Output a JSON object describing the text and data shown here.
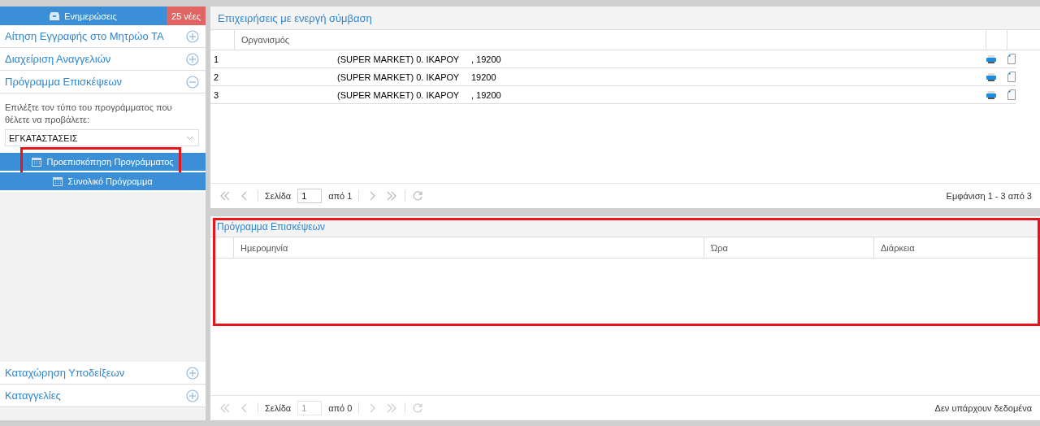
{
  "sidebar": {
    "notifications": {
      "label": "Ενημερώσεις",
      "badge": "25 νέες"
    },
    "items_top": [
      {
        "label": "Αίτηση Εγγραφής στο Μητρώο ΤΑ",
        "expanded": false
      },
      {
        "label": "Διαχείριση Αναγγελιών",
        "expanded": false
      },
      {
        "label": "Πρόγραμμα Επισκέψεων",
        "expanded": true
      }
    ],
    "panel": {
      "prompt": "Επιλέξτε τον τύπο του προγράμματος που θέλετε να προβάλετε:",
      "select_value": "ΕΓΚΑΤΑΣΤΑΣΕΙΣ",
      "buttons": [
        {
          "label": "Προεπισκόπηση Προγράμματος",
          "highlighted": true
        },
        {
          "label": "Συνολικό Πρόγραμμα",
          "highlighted": false
        }
      ]
    },
    "items_bottom": [
      {
        "label": "Καταχώρηση Υποδείξεων",
        "expanded": false
      },
      {
        "label": "Καταγγελίες",
        "expanded": false
      }
    ]
  },
  "companies": {
    "title": "Επιχειρήσεις με ενεργή σύμβαση",
    "columns": [
      "Οργανισμός"
    ],
    "rows": [
      {
        "number": "1",
        "name": "(SUPER MARKET) 0. ΙΚΑΡΟΥ",
        "address": ", 19200"
      },
      {
        "number": "2",
        "name": "(SUPER MARKET) 0. ΙΚΑΡΟΥ",
        "address": "19200"
      },
      {
        "number": "3",
        "name": "(SUPER MARKET) 0. ΙΚΑΡΟΥ",
        "address": ", 19200"
      }
    ],
    "pager": {
      "page_label": "Σελίδα",
      "page": "1",
      "of": "από 1",
      "info": "Εμφάνιση 1 - 3 από 3",
      "disabled": false
    }
  },
  "schedule": {
    "title": "Πρόγραμμα Επισκέψεων",
    "highlighted": true,
    "columns": [
      "Ημερομηνία",
      "Ώρα",
      "Διάρκεια"
    ],
    "pager": {
      "page_label": "Σελίδα",
      "page": "1",
      "of": "από 0",
      "info": "Δεν υπάρχουν δεδομένα",
      "disabled": true
    }
  }
}
